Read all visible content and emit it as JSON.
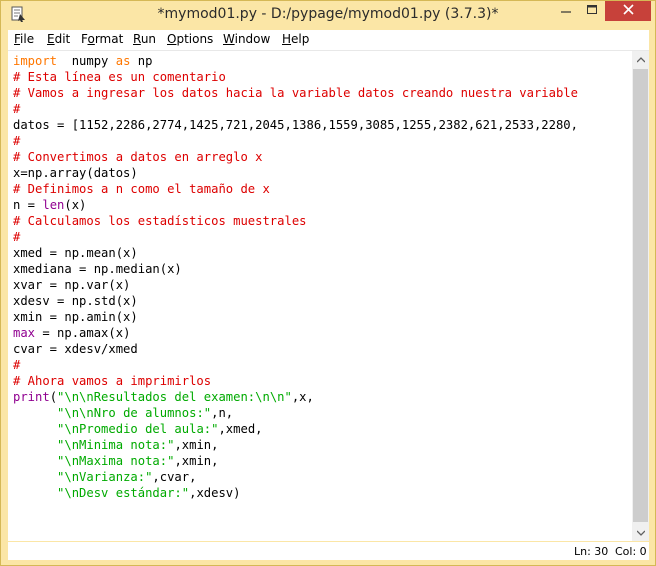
{
  "window": {
    "title": "*mymod01.py - D:/pypage/mymod01.py (3.7.3)*"
  },
  "menu": [
    {
      "pre": "",
      "u": "F",
      "post": "ile"
    },
    {
      "pre": "",
      "u": "E",
      "post": "dit"
    },
    {
      "pre": "F",
      "u": "o",
      "post": "rmat"
    },
    {
      "pre": "",
      "u": "R",
      "post": "un"
    },
    {
      "pre": "",
      "u": "O",
      "post": "ptions"
    },
    {
      "pre": "",
      "u": "W",
      "post": "indow"
    },
    {
      "pre": "",
      "u": "H",
      "post": "elp"
    }
  ],
  "code_lines": [
    [
      [
        "kw",
        "import"
      ],
      [
        "",
        "  numpy "
      ],
      [
        "kw",
        "as"
      ],
      [
        "",
        " np"
      ]
    ],
    [
      [
        "cm",
        "# Esta línea es un comentario"
      ]
    ],
    [
      [
        "cm",
        "# Vamos a ingresar los datos hacia la variable datos creando nuestra variable"
      ]
    ],
    [
      [
        "cm",
        "#"
      ]
    ],
    [
      [
        "",
        "datos = [1152,2286,2774,1425,721,2045,1386,1559,3085,1255,2382,621,2533,2280,"
      ]
    ],
    [
      [
        "cm",
        "#"
      ]
    ],
    [
      [
        "cm",
        "# Convertimos a datos en arreglo x"
      ]
    ],
    [
      [
        "",
        "x=np.array(datos)"
      ]
    ],
    [
      [
        "cm",
        "# Definimos a n como el tamaño de x"
      ]
    ],
    [
      [
        "",
        "n = "
      ],
      [
        "bi",
        "len"
      ],
      [
        "",
        "(x)"
      ]
    ],
    [
      [
        "cm",
        "# Calculamos los estadísticos muestrales"
      ]
    ],
    [
      [
        "cm",
        "#"
      ]
    ],
    [
      [
        "",
        "xmed = np.mean(x)"
      ]
    ],
    [
      [
        "",
        "xmediana = np.median(x)"
      ]
    ],
    [
      [
        "",
        "xvar = np.var(x)"
      ]
    ],
    [
      [
        "",
        "xdesv = np.std(x)"
      ]
    ],
    [
      [
        "",
        "xmin = np.amin(x)"
      ]
    ],
    [
      [
        "bi",
        "max"
      ],
      [
        "",
        " = np.amax(x)"
      ]
    ],
    [
      [
        "",
        "cvar = xdesv/xmed"
      ]
    ],
    [
      [
        "cm",
        "#"
      ]
    ],
    [
      [
        "cm",
        "# Ahora vamos a imprimirlos"
      ]
    ],
    [
      [
        "bi",
        "print"
      ],
      [
        "",
        "("
      ],
      [
        "st",
        "\"\\n\\nResultados del examen:\\n\\n\""
      ],
      [
        "",
        ",x,"
      ]
    ],
    [
      [
        "",
        "      "
      ],
      [
        "st",
        "\"\\n\\nNro de alumnos:\""
      ],
      [
        "",
        ",n,"
      ]
    ],
    [
      [
        "",
        "      "
      ],
      [
        "st",
        "\"\\nPromedio del aula:\""
      ],
      [
        "",
        ",xmed,"
      ]
    ],
    [
      [
        "",
        "      "
      ],
      [
        "st",
        "\"\\nMinima nota:\""
      ],
      [
        "",
        ",xmin,"
      ]
    ],
    [
      [
        "",
        "      "
      ],
      [
        "st",
        "\"\\nMaxima nota:\""
      ],
      [
        "",
        ",xmin,"
      ]
    ],
    [
      [
        "",
        "      "
      ],
      [
        "st",
        "\"\\nVarianza:\""
      ],
      [
        "",
        ",cvar,"
      ]
    ],
    [
      [
        "",
        "      "
      ],
      [
        "st",
        "\"\\nDesv estándar:\""
      ],
      [
        "",
        ",xdesv)"
      ]
    ]
  ],
  "status": {
    "line": "Ln: 30",
    "col": "Col: 0"
  },
  "colors": {
    "titlebar": "#fbe6a6",
    "keyword": "#ff7700",
    "builtin": "#900090",
    "comment": "#dd0000",
    "string": "#00aa00",
    "close_button": "#c7413a"
  },
  "icons": [
    "python-idle-icon",
    "minimize-icon",
    "maximize-icon",
    "close-icon",
    "scroll-up-arrow-icon",
    "scroll-down-arrow-icon",
    "scroll-left-arrow-icon",
    "scroll-right-arrow-icon"
  ]
}
